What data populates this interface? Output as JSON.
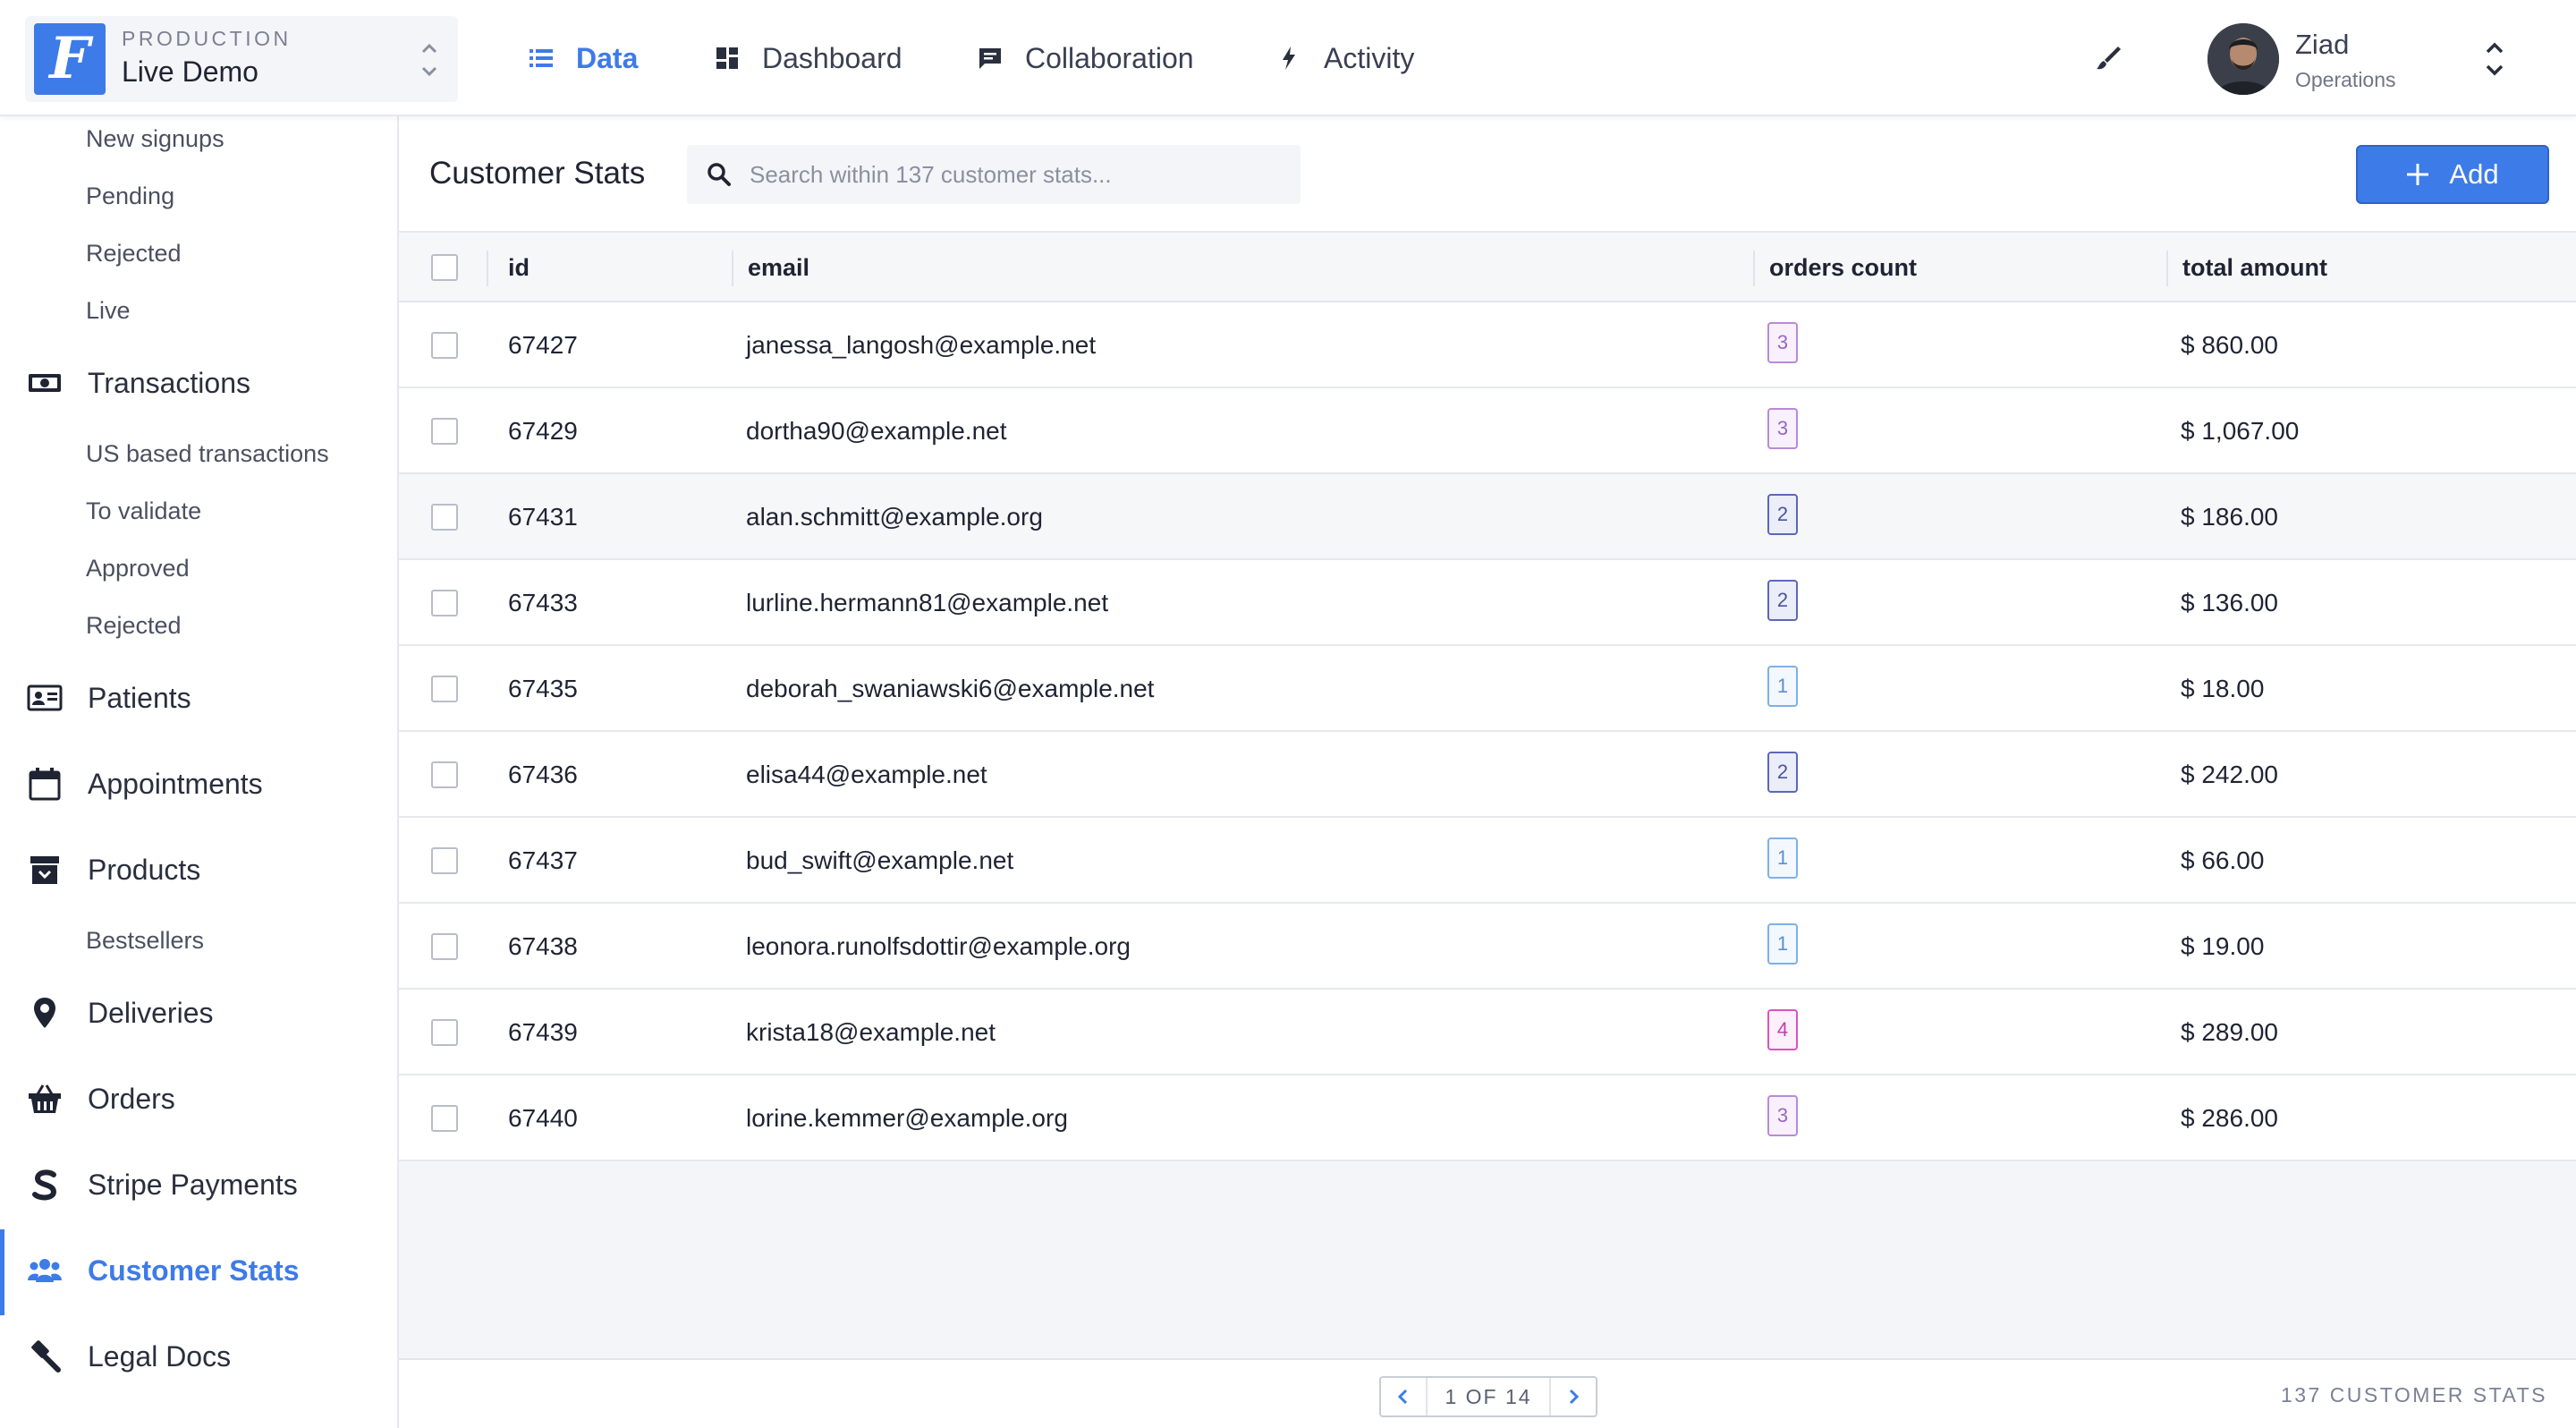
{
  "env": {
    "label": "PRODUCTION",
    "name": "Live Demo",
    "logo_letter": "F"
  },
  "nav": {
    "items": [
      {
        "label": "Data",
        "icon": "list-icon",
        "active": true
      },
      {
        "label": "Dashboard",
        "icon": "dashboard-icon",
        "active": false
      },
      {
        "label": "Collaboration",
        "icon": "chat-icon",
        "active": false
      },
      {
        "label": "Activity",
        "icon": "bolt-icon",
        "active": false
      }
    ]
  },
  "user": {
    "name": "Ziad",
    "role": "Operations"
  },
  "sidebar": {
    "items": [
      {
        "type": "sub",
        "label": "New signups"
      },
      {
        "type": "sub",
        "label": "Pending"
      },
      {
        "type": "sub",
        "label": "Rejected"
      },
      {
        "type": "sub",
        "label": "Live"
      },
      {
        "type": "main",
        "label": "Transactions",
        "icon": "cash-icon"
      },
      {
        "type": "sub",
        "label": "US based transactions"
      },
      {
        "type": "sub",
        "label": "To validate"
      },
      {
        "type": "sub",
        "label": "Approved"
      },
      {
        "type": "sub",
        "label": "Rejected"
      },
      {
        "type": "main",
        "label": "Patients",
        "icon": "id-card-icon"
      },
      {
        "type": "main",
        "label": "Appointments",
        "icon": "calendar-icon"
      },
      {
        "type": "main",
        "label": "Products",
        "icon": "archive-icon"
      },
      {
        "type": "sub",
        "label": "Bestsellers"
      },
      {
        "type": "main",
        "label": "Deliveries",
        "icon": "map-pin-icon"
      },
      {
        "type": "main",
        "label": "Orders",
        "icon": "basket-icon"
      },
      {
        "type": "main",
        "label": "Stripe Payments",
        "icon": "stripe-icon"
      },
      {
        "type": "main",
        "label": "Customer Stats",
        "icon": "users-icon",
        "active": true
      },
      {
        "type": "main",
        "label": "Legal Docs",
        "icon": "gavel-icon"
      }
    ]
  },
  "main": {
    "title": "Customer Stats",
    "search_placeholder": "Search within 137 customer stats...",
    "add_label": "Add",
    "columns": [
      "id",
      "email",
      "orders count",
      "total amount"
    ],
    "rows": [
      {
        "id": "67427",
        "email": "janessa_langosh@example.net",
        "orders": "3",
        "amount": "$ 860.00"
      },
      {
        "id": "67429",
        "email": "dortha90@example.net",
        "orders": "3",
        "amount": "$ 1,067.00"
      },
      {
        "id": "67431",
        "email": "alan.schmitt@example.org",
        "orders": "2",
        "amount": "$ 186.00"
      },
      {
        "id": "67433",
        "email": "lurline.hermann81@example.net",
        "orders": "2",
        "amount": "$ 136.00"
      },
      {
        "id": "67435",
        "email": "deborah_swaniawski6@example.net",
        "orders": "1",
        "amount": "$ 18.00"
      },
      {
        "id": "67436",
        "email": "elisa44@example.net",
        "orders": "2",
        "amount": "$ 242.00"
      },
      {
        "id": "67437",
        "email": "bud_swift@example.net",
        "orders": "1",
        "amount": "$ 66.00"
      },
      {
        "id": "67438",
        "email": "leonora.runolfsdottir@example.org",
        "orders": "1",
        "amount": "$ 19.00"
      },
      {
        "id": "67439",
        "email": "krista18@example.net",
        "orders": "4",
        "amount": "$ 289.00"
      },
      {
        "id": "67440",
        "email": "lorine.kemmer@example.org",
        "orders": "3",
        "amount": "$ 286.00"
      }
    ],
    "badge_colors": {
      "1": {
        "border": "#7fb0e6",
        "text": "#5a90d0",
        "bg": "#f3f8fe"
      },
      "2": {
        "border": "#5c67b8",
        "text": "#4a559e",
        "bg": "#ebedf8"
      },
      "3": {
        "border": "#b98ad8",
        "text": "#9a66c2",
        "bg": "#f8f1fd"
      },
      "4": {
        "border": "#d455c4",
        "text": "#c040b0",
        "bg": "#fcf0fa"
      }
    }
  },
  "footer": {
    "page_label": "1 OF 14",
    "total_label": "137 CUSTOMER STATS"
  },
  "colors": {
    "accent": "#3d7be8",
    "text": "#1f2433",
    "muted": "#7a8194"
  }
}
